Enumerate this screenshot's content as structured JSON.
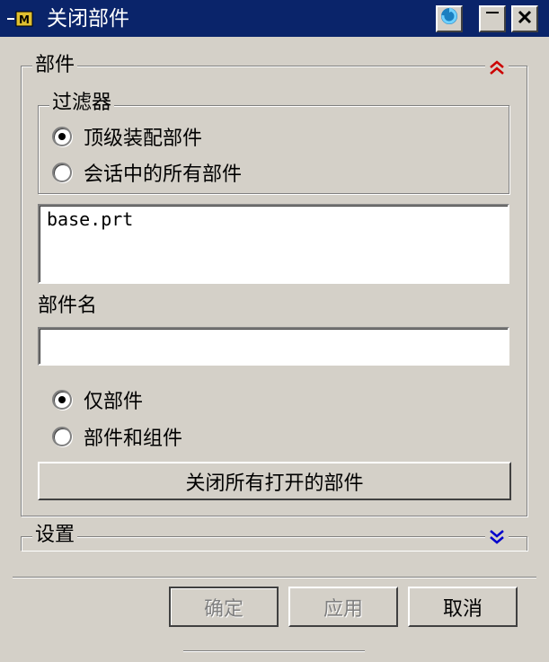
{
  "window": {
    "title": "关闭部件",
    "icon": "nx-app-icon"
  },
  "titlebar_buttons": [
    {
      "name": "undo-icon"
    },
    {
      "name": "minimize-icon"
    },
    {
      "name": "close-icon"
    }
  ],
  "part_group": {
    "label": "部件",
    "toggle_icon": "double-chevron-up-icon",
    "toggle_color": "#cc0000"
  },
  "filter_group": {
    "label": "过滤器",
    "options": [
      {
        "label": "顶级装配部件",
        "checked": true
      },
      {
        "label": "会话中的所有部件",
        "checked": false
      }
    ]
  },
  "part_list": {
    "items": [
      "base.prt"
    ]
  },
  "part_name": {
    "label": "部件名",
    "value": ""
  },
  "scope": {
    "options": [
      {
        "label": "仅部件",
        "checked": true
      },
      {
        "label": "部件和组件",
        "checked": false
      }
    ]
  },
  "close_all_button": "关闭所有打开的部件",
  "settings_group": {
    "label": "设置",
    "toggle_icon": "double-chevron-down-icon",
    "toggle_color": "#0000cc"
  },
  "footer": {
    "ok": "确定",
    "apply": "应用",
    "cancel": "取消"
  }
}
